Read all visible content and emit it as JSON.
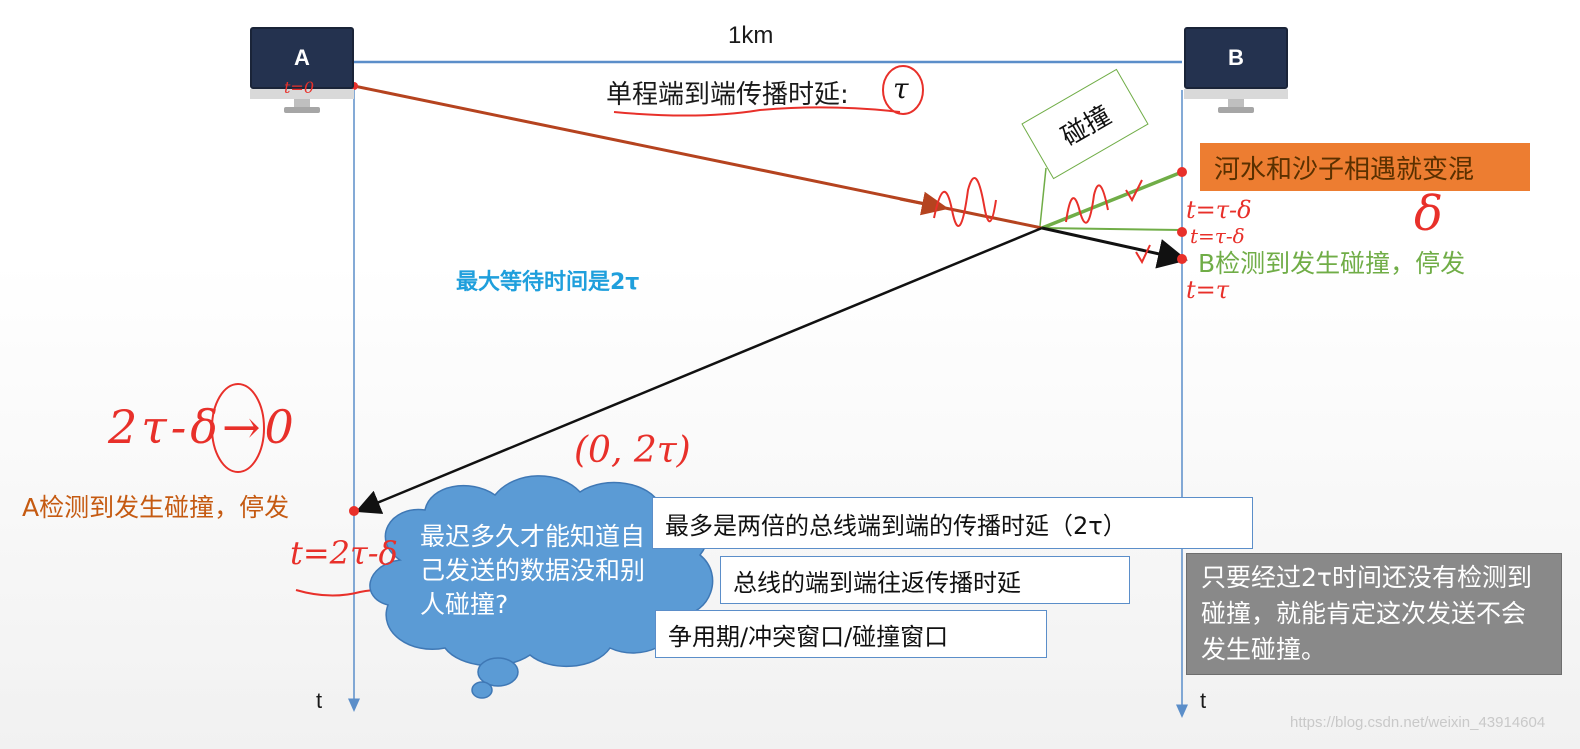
{
  "nodes": {
    "a_label": "A",
    "b_label": "B"
  },
  "distance_label": "1km",
  "delay_label": "单程端到端传播时延:",
  "delay_symbol": "τ",
  "collision_tag": "碰撞",
  "mud_note": "河水和沙子相遇就变混",
  "b_detect": "B检测到发生碰撞，停发",
  "a_detect": "A检测到发生碰撞，停发",
  "max_wait": "最大等待时间是2τ",
  "cloud_question": "最迟多久才能知道自己发送的数据没和别人碰撞?",
  "answer_boxes": [
    "最多是两倍的总线端到端的传播时延（2τ）",
    "总线的端到端往返传播时延",
    "争用期/冲突窗口/碰撞窗口"
  ],
  "grey_note": "只要经过2τ时间还没有检测到碰撞，就能肯定这次发送不会发生碰撞。",
  "time_axis_label": "t",
  "handwriting": {
    "t0": "t=0",
    "b_t1": "t=τ-δ",
    "b_t2": "t=τ-δ",
    "b_t3": "t=τ",
    "delta": "δ",
    "limit": "2τ-δ→0",
    "interval": "(0, 2τ)",
    "a_t": "t=2τ-δ"
  },
  "watermark": "https://blog.csdn.net/weixin_43914604",
  "colors": {
    "axis_blue": "#5b8ec9",
    "signal_brown": "#b5431f",
    "annotation_red": "#e8302a",
    "annotation_green": "#70ad47",
    "highlight_blue": "#1f9fdc",
    "cloud_blue": "#5b9bd5",
    "orange_text": "#c55a11"
  }
}
